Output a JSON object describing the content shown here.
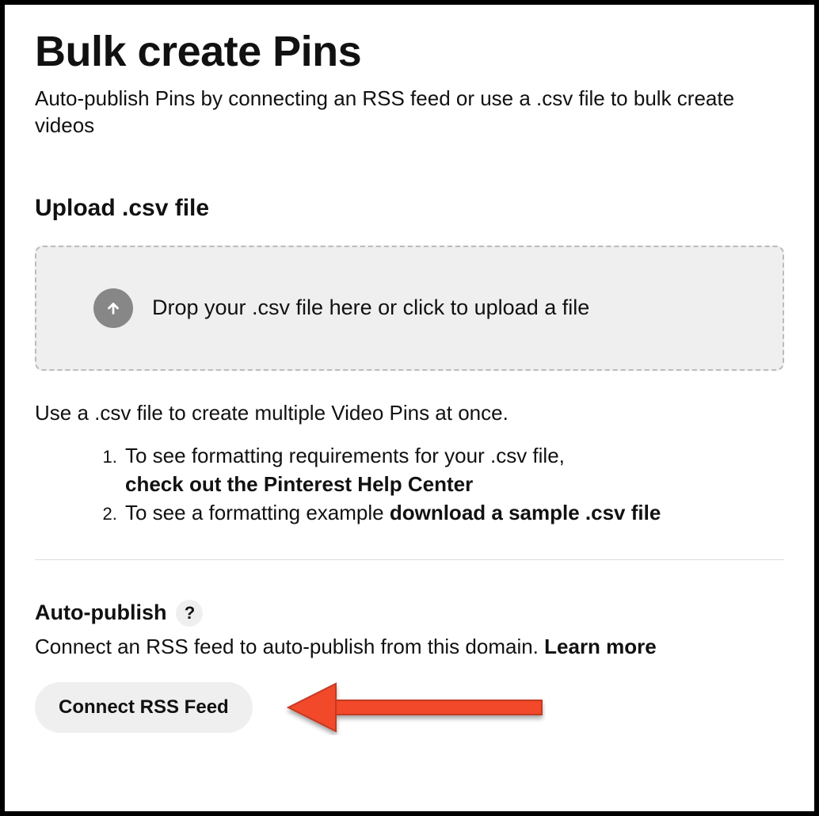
{
  "header": {
    "title": "Bulk create Pins",
    "subtitle": "Auto-publish Pins by connecting an RSS feed or use a .csv file to bulk create videos"
  },
  "upload": {
    "heading": "Upload .csv file",
    "dropzone_text": "Drop your .csv file here or click to upload a file",
    "info": "Use a .csv file to create multiple Video Pins at once.",
    "steps": [
      {
        "prefix": "To see formatting requirements for your .csv file, ",
        "link": "check out the Pinterest Help Center"
      },
      {
        "prefix": "To see a formatting example ",
        "link": "download a sample .csv file"
      }
    ]
  },
  "auto_publish": {
    "heading": "Auto-publish",
    "help_symbol": "?",
    "description_prefix": "Connect an RSS feed to auto-publish from this domain. ",
    "learn_more": "Learn more",
    "button": "Connect RSS Feed"
  }
}
